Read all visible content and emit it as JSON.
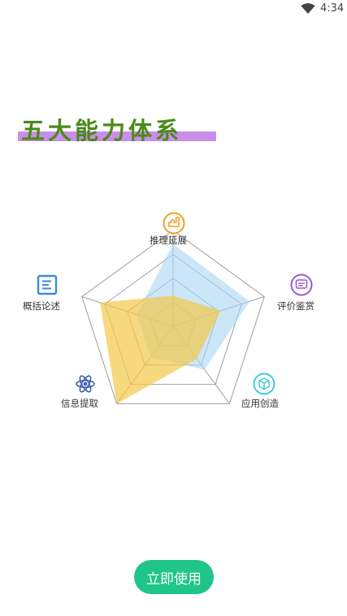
{
  "status_bar": {
    "time": "4:34",
    "icons": [
      "wifi-icon"
    ]
  },
  "page": {
    "title": "五大能力体系",
    "start_button_label": "立即使用"
  },
  "colors": {
    "title_text": "#4a8a1a",
    "title_highlight": "#c98ee8",
    "button_bg": "#1fc58a",
    "radar_grid": "#9e9e9e",
    "series_blue": "#a9d6f5",
    "series_yellow": "#f2c94c"
  },
  "capabilities": [
    {
      "label": "推理延展",
      "icon": "puzzle-icon",
      "icon_color": "#f0a020"
    },
    {
      "label": "评价鉴赏",
      "icon": "message-icon",
      "icon_color": "#9b59d0"
    },
    {
      "label": "应用创造",
      "icon": "cube-icon",
      "icon_color": "#3fc9e0"
    },
    {
      "label": "信息提取",
      "icon": "atom-icon",
      "icon_color": "#3a5fb0"
    },
    {
      "label": "概括论述",
      "icon": "document-icon",
      "icon_color": "#3a8ae0"
    }
  ],
  "chart_data": {
    "type": "radar",
    "categories": [
      "推理延展",
      "评价鉴赏",
      "应用创造",
      "信息提取",
      "概括论述"
    ],
    "rmax": 5,
    "rings": 4,
    "series": [
      {
        "values": [
          4.3,
          4.2,
          2.8,
          2.0,
          2.0
        ],
        "color": "#a9d6f5"
      },
      {
        "values": [
          1.6,
          2.6,
          2.1,
          5.0,
          4.0
        ],
        "color": "#f2c94c"
      }
    ]
  }
}
